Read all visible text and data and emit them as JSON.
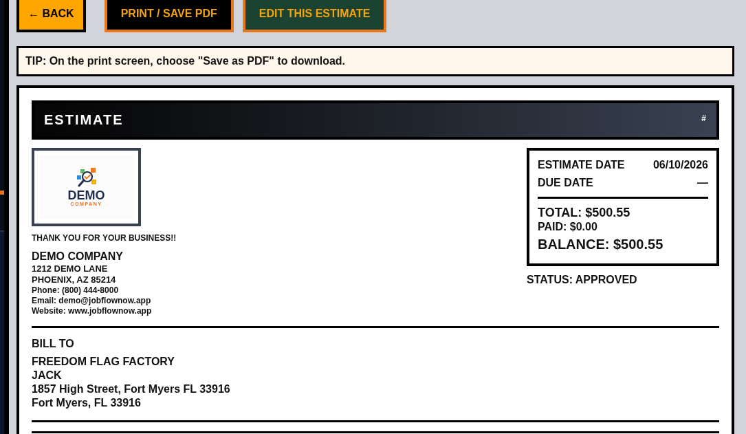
{
  "toolbar": {
    "buttons": [
      {
        "label": "← BACK",
        "kind": "back"
      },
      {
        "label": "PRINT / SAVE PDF",
        "kind": "print"
      },
      {
        "label": "EDIT THIS ESTIMATE",
        "kind": "edit"
      }
    ]
  },
  "tip": "TIP: On the print screen, choose \"Save as PDF\" to download.",
  "document": {
    "header": {
      "title": "ESTIMATE",
      "number": "#"
    },
    "logo": {
      "wordmark": "DEMO",
      "tagline": "COMPANY"
    },
    "thank_you": "THANK YOU FOR YOUR BUSINESS!!",
    "company": {
      "name": "DEMO COMPANY",
      "address_lines": [
        "1212 DEMO LANE",
        "PHOENIX, AZ 85214"
      ],
      "contact_lines": [
        "Phone: (800) 444-8000",
        "Email: demo@jobflownow.app",
        "Website: www.jobflownow.app"
      ]
    },
    "summary": {
      "dates": [
        {
          "label": "ESTIMATE DATE",
          "value": "06/10/2026"
        },
        {
          "label": "DUE DATE",
          "value": "—"
        }
      ],
      "total": "TOTAL: $500.55",
      "paid": "PAID: $0.00",
      "balance": "BALANCE: $500.55"
    },
    "status": "STATUS: APPROVED",
    "bill_to": {
      "heading": "BILL TO",
      "lines": [
        "FREEDOM FLAG FACTORY",
        "JACK",
        "1857 High Street, Fort Myers FL 33916",
        "Fort Myers, FL 33916"
      ]
    }
  }
}
